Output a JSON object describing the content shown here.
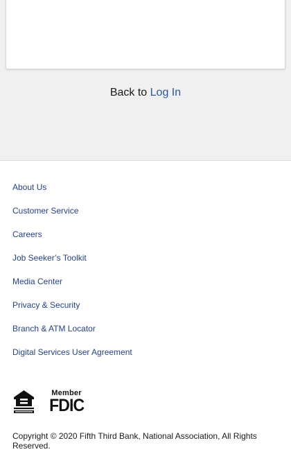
{
  "back_line": {
    "prefix": "Back to",
    "link_label": "Log In"
  },
  "footer": {
    "links": [
      {
        "label": "About Us"
      },
      {
        "label": "Customer Service"
      },
      {
        "label": "Careers"
      },
      {
        "label": "Job Seeker’s Toolkit"
      },
      {
        "label": "Media Center"
      },
      {
        "label": "Privacy & Security"
      },
      {
        "label": "Branch & ATM Locator"
      },
      {
        "label": "Digital Services User Agreement"
      }
    ],
    "logos": {
      "equal_housing": "EQUAL HOUSING LENDER",
      "fdic_member": "Member",
      "fdic_word": "FDIC"
    },
    "copyright": "Copyright © 2020 Fifth Third Bank, National Association, All Rights Reserved."
  },
  "colors": {
    "link": "#24438a",
    "login_link": "#2a55a3",
    "top_background": "#f0f0f0"
  }
}
